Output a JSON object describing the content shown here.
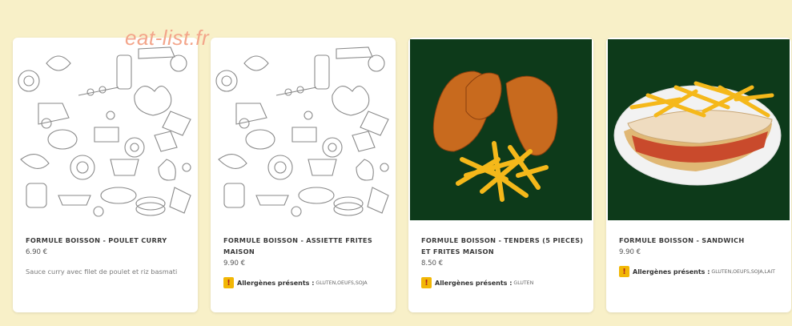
{
  "watermark": "eat-list.fr",
  "cards": [
    {
      "title": "FORMULE BOISSON - POULET CURRY",
      "price": "6.90 €",
      "description": "Sauce curry avec filet de poulet et riz basmati",
      "image": "food-doodle-pattern"
    },
    {
      "title": "FORMULE BOISSON - ASSIETTE FRITES MAISON",
      "price": "9.90 €",
      "allergen_label": "Allergènes présents :",
      "allergens": "GLUTEN,OEUFS,SOJA",
      "image": "food-doodle-pattern"
    },
    {
      "title": "FORMULE BOISSON - TENDERS (5 PIECES) ET FRITES MAISON",
      "price": "8.50 €",
      "allergen_label": "Allergènes présents :",
      "allergens": "GLUTEN",
      "image": "tenders-and-fries-photo"
    },
    {
      "title": "FORMULE BOISSON - SANDWICH",
      "price": "9.90 €",
      "allergen_label": "Allergènes présents :",
      "allergens": "GLUTEN,OEUFS,SOJA,LAIT",
      "image": "sandwich-with-fries-photo"
    }
  ],
  "colors": {
    "page_background": "#f8f0c8",
    "card_background": "#ffffff",
    "photo_background": "#0d3a1a",
    "warning_badge": "#f2b705"
  },
  "icons": {
    "allergen": "warning-icon"
  }
}
